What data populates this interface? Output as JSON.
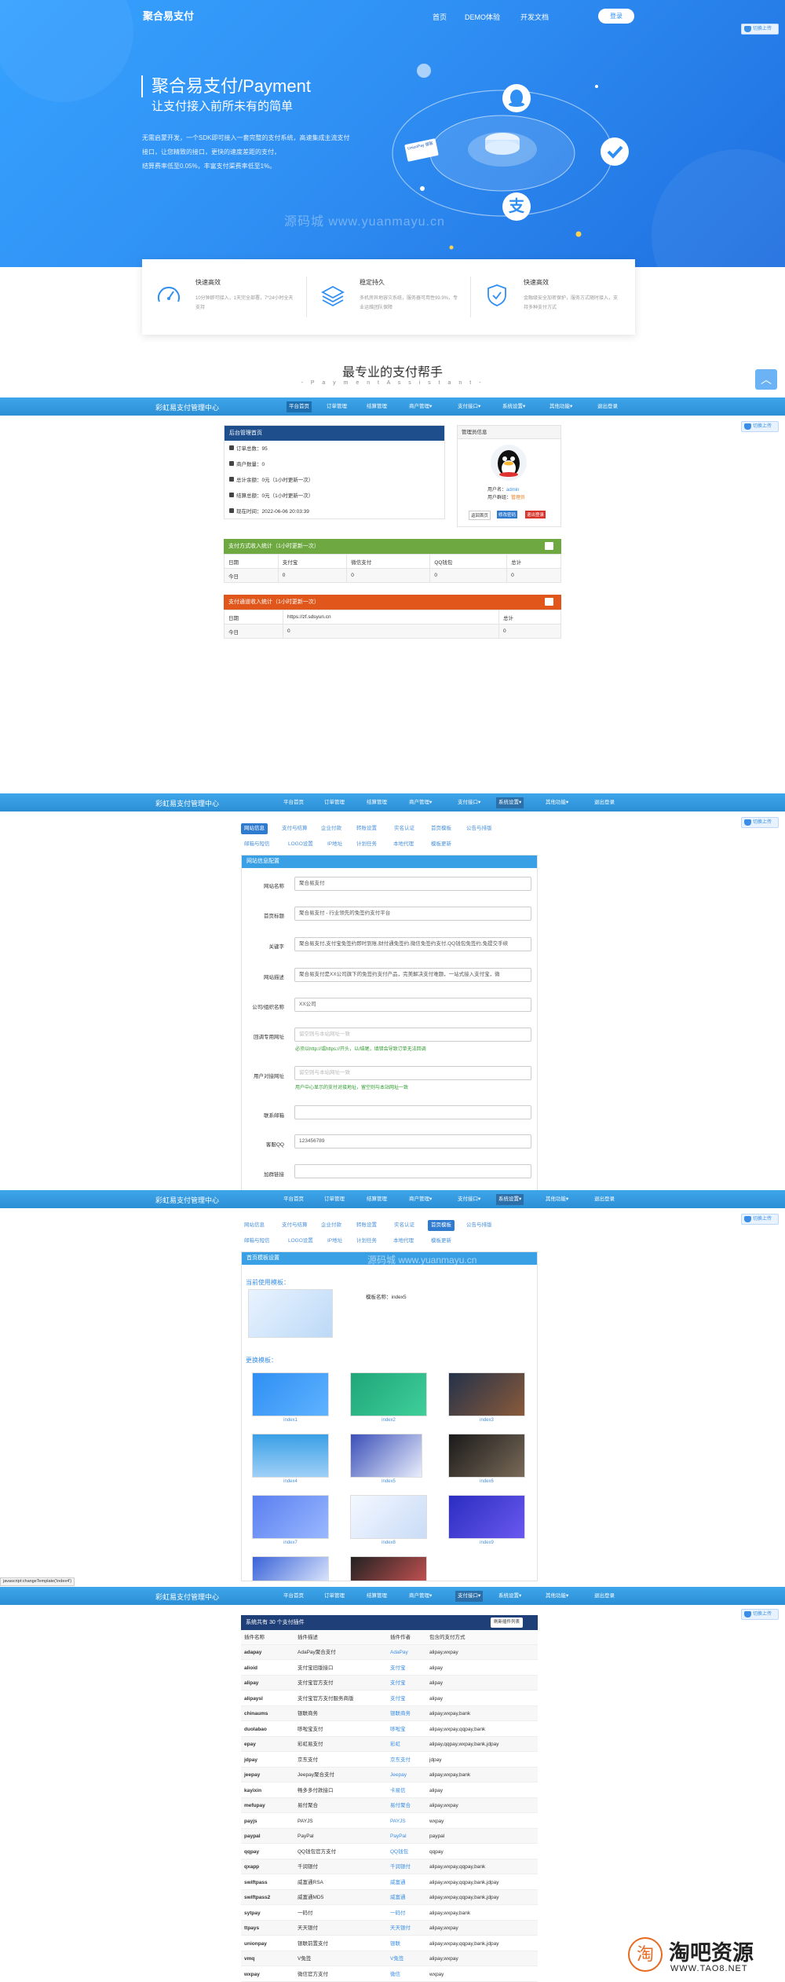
{
  "hero": {
    "brand": "聚合易支付",
    "nav": [
      "首页",
      "DEMO体验",
      "开发文档"
    ],
    "login": "登录",
    "title": "聚合易支付/Payment",
    "subtitle": "让支付接入前所未有的简单",
    "desc": [
      "无需启蒙开发，一个SDK即可接入一套完整的支付系统，高速集成主流支付",
      "接口，让您精致的接口，更快的速度差距的支付，",
      "结算费率低至0.05%，丰富支付渠费率低至1%。"
    ],
    "watermark": "源码城  www.yuanmayu.cn",
    "unionpay_label": "UnionPay 银联",
    "float_btn": "切换上传"
  },
  "features": [
    {
      "title": "快速高效",
      "icon": "speedometer-icon",
      "desc": "10分钟即可接入，1天完全部署，7*24小时全天支持"
    },
    {
      "title": "稳定持久",
      "icon": "layers-icon",
      "desc": "多机房异地容灾系统，服务器可用性99.9%，专业运维团队保障"
    },
    {
      "title": "快速高效",
      "icon": "shield-icon",
      "desc": "金融级安全加密保护，服务方式随时接入，支持多种支付方式"
    }
  ],
  "slogan": "最专业的支付帮手",
  "slogan_en": "- P a y m e n t   A s s i s t a n t -",
  "admin": {
    "title": "彩虹易支付管理中心",
    "menu": [
      "平台首页",
      "订单管理",
      "结算管理",
      "商户管理▾",
      "支付接口▾",
      "系统设置▾",
      "其他功能▾",
      "退出登录"
    ]
  },
  "dashboard": {
    "panel_title": "后台管理首页",
    "rows": [
      "订单总数：95",
      "商户数量：0",
      "总计余额：0元（1小时更新一次）",
      "结算总额：0元（1小时更新一次）",
      "现在时间：2022-06-06 20:03:39"
    ],
    "admin_box_title": "管理员信息",
    "user_label": "用户名：",
    "user_value": "admin",
    "group_label": "用户群组：",
    "group_value": "管理员",
    "actions": [
      "返回首页",
      "修改密码",
      "退出登录"
    ],
    "stats1": {
      "title": "支付方式收入统计（1小时更新一次）",
      "headers": [
        "日期",
        "支付宝",
        "微信支付",
        "QQ钱包",
        "总计"
      ],
      "rows": [
        [
          "今日",
          "0",
          "0",
          "0",
          "0"
        ]
      ]
    },
    "stats2": {
      "title": "支付通道收入统计（1小时更新一次）",
      "headers": [
        "日期",
        "https://zf.sdsyun.cn",
        "总计"
      ],
      "rows": [
        [
          "今日",
          "0",
          "0"
        ]
      ]
    }
  },
  "settings": {
    "tabs_row1": [
      "网站信息",
      "支付与结算",
      "企业付款",
      "转账设置",
      "实名认证",
      "首页模板",
      "公告与排版"
    ],
    "tabs_row2": [
      "邮箱与短信",
      "LOGO设置",
      "IP地址",
      "计划任务",
      "本地代理",
      "模板更新"
    ],
    "panel_title": "网站信息配置",
    "fields": [
      {
        "label": "网站名称",
        "value": "聚合易支付",
        "ph": ""
      },
      {
        "label": "首页标题",
        "value": "聚合易支付 - 行业领先的免签约支付平台",
        "ph": ""
      },
      {
        "label": "关键字",
        "value": "聚合易支付,支付宝免签约即时到账,财付通免签约,微信免签约支付,QQ钱包免签约,免提交手续",
        "ph": ""
      },
      {
        "label": "网站描述",
        "value": "聚合易支付是XX公司旗下的免签约支付产品，完美解决支付难题，一站式接入支付宝，微",
        "ph": ""
      },
      {
        "label": "公司/组织名称",
        "value": "XX公司",
        "ph": ""
      },
      {
        "label": "回调专用网址",
        "value": "",
        "ph": "留空则与本站网址一致",
        "hint": "必须以http://或https://开头，以/结尾，填错会导致订单无法回调"
      },
      {
        "label": "用户对接网址",
        "value": "",
        "ph": "留空则与本站网址一致",
        "hint": "用户中心显示的支付对接地址，留空则与本站网址一致"
      },
      {
        "label": "联系邮箱",
        "value": "",
        "ph": ""
      },
      {
        "label": "客服QQ",
        "value": "123456789",
        "ph": ""
      },
      {
        "label": "加群链接",
        "value": "",
        "ph": ""
      }
    ]
  },
  "templates": {
    "panel_title": "首页模板设置",
    "current_label": "当前使用模板：",
    "current_name": "模板名称：index5",
    "more_label": "更换模板：",
    "items": [
      "index1",
      "index2",
      "index3",
      "index4",
      "index5",
      "index6",
      "index7",
      "index8",
      "index9",
      "",
      ""
    ],
    "status_url": "javascript:changeTemplate('index4')",
    "watermark": "源码城  www.yuanmayu.cn"
  },
  "plugins": {
    "title": "系统共有 30 个支付插件",
    "refresh": "刷新插件列表",
    "headers": [
      "插件名称",
      "插件描述",
      "插件作者",
      "包含的支付方式"
    ],
    "rows": [
      [
        "adapay",
        "AdaPay聚合支付",
        "AdaPay",
        "alipay,wxpay"
      ],
      [
        "alioid",
        "支付宝旧版接口",
        "支付宝",
        "alipay"
      ],
      [
        "alipay",
        "支付宝官方支付",
        "支付宝",
        "alipay"
      ],
      [
        "alipaysl",
        "支付宝官方支付服务商版",
        "支付宝",
        "alipay"
      ],
      [
        "chinaums",
        "银联商务",
        "银联商务",
        "alipay,wxpay,bank"
      ],
      [
        "duolabao",
        "哆啦宝支付",
        "哆啦宝",
        "alipay,wxpay,qqpay,bank"
      ],
      [
        "epay",
        "彩虹易支付",
        "彩虹",
        "alipay,qqpay,wxpay,bank,jdpay"
      ],
      [
        "jdpay",
        "京东支付",
        "京东支付",
        "jdpay"
      ],
      [
        "jeepay",
        "Jeepay聚合支付",
        "Jeepay",
        "alipay,wxpay,bank"
      ],
      [
        "kayixin",
        "畅多多付款接口",
        "卡易信",
        "alipay"
      ],
      [
        "mefupay",
        "易付聚合",
        "易付聚合",
        "alipay,wxpay"
      ],
      [
        "payjs",
        "PAYJS",
        "PAYJS",
        "wxpay"
      ],
      [
        "paypal",
        "PayPal",
        "PayPal",
        "paypal"
      ],
      [
        "qqpay",
        "QQ钱包官方支付",
        "QQ钱包",
        "qqpay"
      ],
      [
        "qxapp",
        "千润银付",
        "千润银付",
        "alipay,wxpay,qqpay,bank"
      ],
      [
        "swiftpass",
        "威富通RSA",
        "威富通",
        "alipay,wxpay,qqpay,bank,jdpay"
      ],
      [
        "swiftpass2",
        "威富通MD5",
        "威富通",
        "alipay,wxpay,qqpay,bank,jdpay"
      ],
      [
        "sytpay",
        "一码付",
        "一码付",
        "alipay,wxpay,bank"
      ],
      [
        "ttpays",
        "天天银付",
        "天天银付",
        "alipay,wxpay"
      ],
      [
        "unionpay",
        "银联前置支付",
        "银联",
        "alipay,wxpay,qqpay,bank,jdpay"
      ],
      [
        "vmq",
        "V免签",
        "V免签",
        "alipay,wxpay"
      ],
      [
        "wxpay",
        "微信官方支付",
        "微信",
        "wxpay"
      ]
    ]
  },
  "corner_logo": {
    "name": "淘吧资源",
    "url": "WWW.TAO8.NET"
  }
}
